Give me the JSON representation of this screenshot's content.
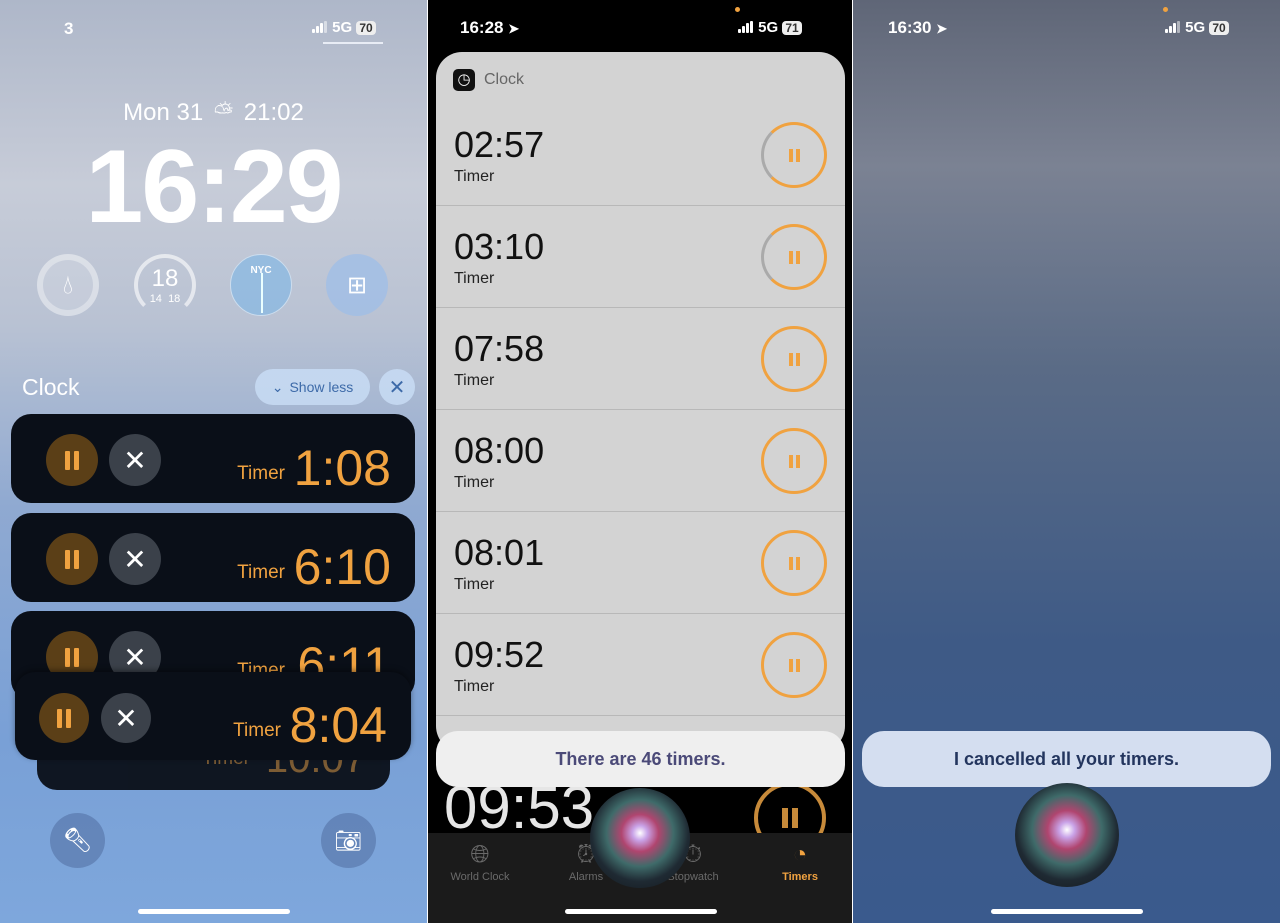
{
  "panel1": {
    "status": {
      "carrier": "3",
      "network": "5G",
      "battery": "70"
    },
    "date": "Mon 31",
    "sunset_time": "21:02",
    "time": "16:29",
    "widgets": [
      {
        "icon": "water-drop-icon"
      },
      {
        "temp": "18",
        "low": "14",
        "high": "18"
      },
      {
        "label": "NYC",
        "icon": "clock-face-icon"
      },
      {
        "icon": "health-icon"
      }
    ],
    "activity": {
      "title": "Clock",
      "show_less": "Show less"
    },
    "timers": [
      {
        "label": "Timer",
        "time": "1:08"
      },
      {
        "label": "Timer",
        "time": "6:10"
      },
      {
        "label": "Timer",
        "time": "6:11"
      },
      {
        "label": "Timer",
        "time": "8:04"
      },
      {
        "label": "Timer",
        "time": "10:07"
      }
    ],
    "colors": {
      "accent": "#f0a240"
    }
  },
  "panel2": {
    "status": {
      "time": "16:28",
      "network": "5G",
      "battery": "71"
    },
    "card_title": "Clock",
    "timers": [
      {
        "time": "02:57",
        "label": "Timer"
      },
      {
        "time": "03:10",
        "label": "Timer"
      },
      {
        "time": "07:58",
        "label": "Timer"
      },
      {
        "time": "08:00",
        "label": "Timer"
      },
      {
        "time": "08:01",
        "label": "Timer"
      },
      {
        "time": "09:52",
        "label": "Timer"
      }
    ],
    "siri_response": "There are 46 timers.",
    "background_timer": "09:53",
    "tabs": [
      {
        "label": "World Clock",
        "icon": "globe-icon"
      },
      {
        "label": "Alarms",
        "icon": "alarm-icon"
      },
      {
        "label": "Stopwatch",
        "icon": "stopwatch-icon"
      },
      {
        "label": "Timers",
        "icon": "timer-icon",
        "active": true
      }
    ]
  },
  "panel3": {
    "status": {
      "time": "16:30",
      "network": "5G",
      "battery": "70"
    },
    "siri_response": "I cancelled all your timers."
  }
}
